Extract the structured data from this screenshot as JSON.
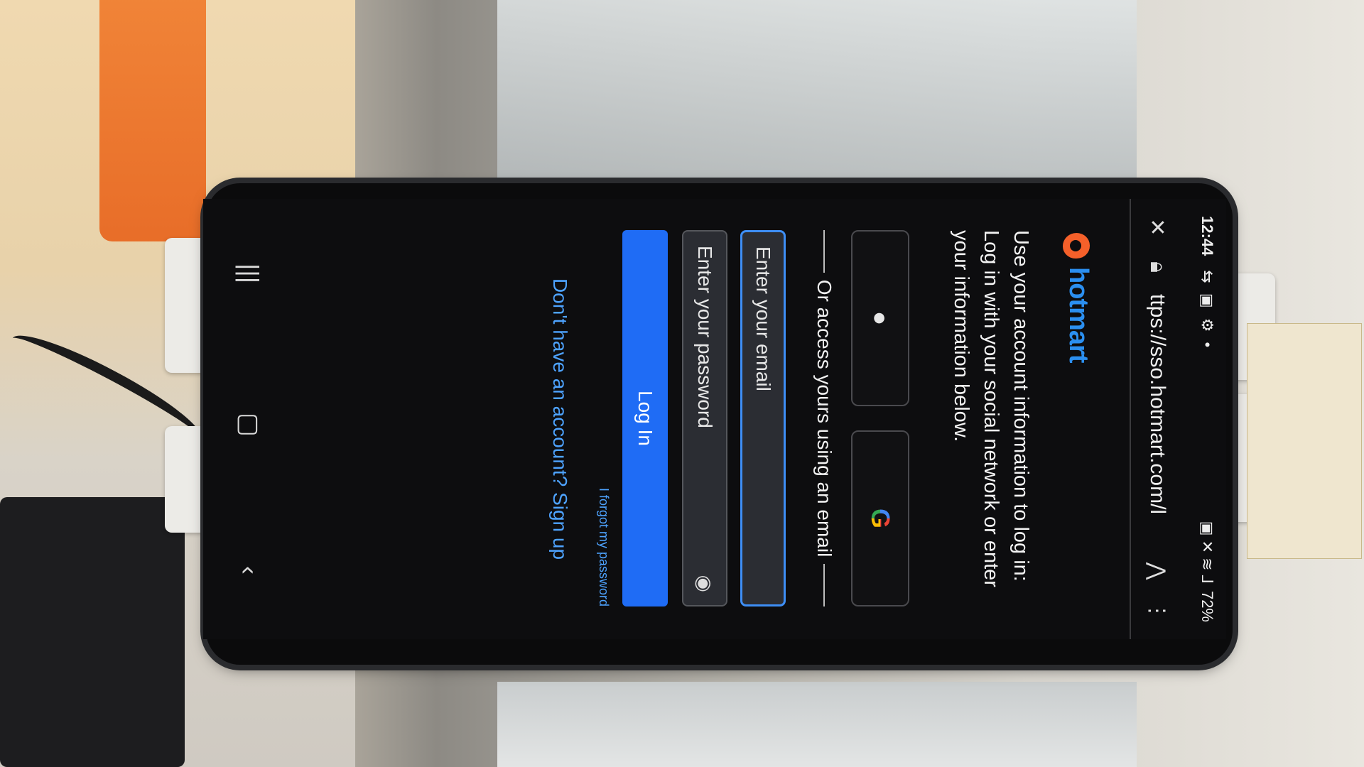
{
  "status_bar": {
    "time": "12:44",
    "left_icons": "⇆ ▣ ⚙ •",
    "right_icons": "▣ ✕ ≋ ⅃",
    "battery": "72%"
  },
  "browser": {
    "url": "ttps://sso.hotmart.com/l",
    "icons": {
      "close": "close-icon",
      "site_info": "lock-icon",
      "share": "share-icon",
      "menu": "more-vert-icon"
    }
  },
  "login": {
    "brand_name": "hotmart",
    "brand_color": "#f5602a",
    "intro_1": "Use your account information to log in:",
    "intro_2": "Log in with your social network or enter your information below.",
    "social": {
      "apple_icon": "apple-icon",
      "google_letter": "G"
    },
    "divider_text": "Or access yours using an email",
    "email_placeholder": "Enter your email",
    "password_placeholder": "Enter your password",
    "login_button": "Log In",
    "forgot_link": "I forgot my password",
    "signup_link": "Don't have an account? Sign up",
    "accent_color": "#1f6cf5"
  },
  "nav_bar": {
    "recents": "recents-icon",
    "home": "home-icon",
    "back": "back-icon"
  }
}
